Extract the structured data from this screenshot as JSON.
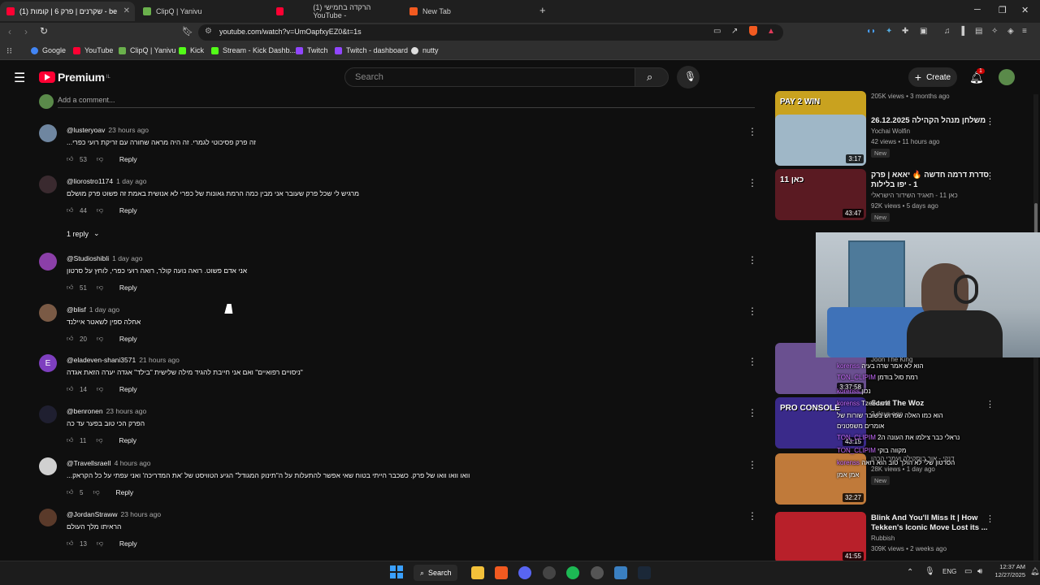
{
  "browser": {
    "tabs": [
      {
        "title": "be - שקרנים | פרק 6 | קומות (1)",
        "active": true
      },
      {
        "title": "ClipQ | Yanivu",
        "active": false
      },
      {
        "title": "הרקדה בחמישי (1) YouTube -",
        "active": false
      },
      {
        "title": "New Tab",
        "active": false
      }
    ],
    "url": "youtube.com/watch?v=UmOapfxyEZ0&t=1s",
    "bookmarks": [
      "Google",
      "YouTube",
      "ClipQ | Yanivu",
      "Kick",
      "Stream - Kick Dashb...",
      "Twitch",
      "Twitch - dashboard",
      "nutty"
    ]
  },
  "header": {
    "logo": "Premium",
    "logo_region": "IL",
    "search_placeholder": "Search",
    "create_label": "Create",
    "notif_count": "1"
  },
  "add_comment": "Add a comment...",
  "comments": [
    {
      "author": "@lusteryoav",
      "time": "23 hours ago",
      "text": "זה פרק פסיכוטי לגמרי. זה היה מראה שחורה עם זריקת רועי כפרי...",
      "likes": "53",
      "reply": "Reply",
      "avatar_color": "#6f86a0",
      "initial": ""
    },
    {
      "author": "@liorostro1174",
      "time": "1 day ago",
      "text": "מרגיש לי שכל פרק שעובר אני מבין כמה הרמת גאונות של כפרי לא אנושית באמת זה פשוט פרק מושלם",
      "likes": "44",
      "reply": "Reply",
      "avatar_color": "#3a2a2f",
      "initial": ""
    },
    {
      "author": "@Studioshibli",
      "time": "1 day ago",
      "text": "אני אדם פשוט. רואה נועה קולר, רואה רועי כפרי, לוחץ על סרטון",
      "likes": "51",
      "reply": "Reply",
      "avatar_color": "#8b3fa8",
      "initial": ""
    },
    {
      "author": "@blisf",
      "time": "1 day ago",
      "text": "אחלה ספין לשאטר איילנד",
      "likes": "20",
      "reply": "Reply",
      "avatar_color": "#7a5a45",
      "initial": ""
    },
    {
      "author": "@eladeven-shani3571",
      "time": "21 hours ago",
      "text": "\"ניסויים רפואיים\" ואם אני חייבת להגיד מילה שלישית \"בילד\" אגדה יערה הזאת אגדה",
      "likes": "14",
      "reply": "Reply",
      "avatar_color": "#7e3fbf",
      "initial": "E"
    },
    {
      "author": "@benronen",
      "time": "23 hours ago",
      "text": "הפרק הכי טוב בפער עד כה",
      "likes": "11",
      "reply": "Reply",
      "avatar_color": "#1f1f30",
      "initial": ""
    },
    {
      "author": "@TravellsraelI",
      "time": "4 hours ago",
      "text": "וואו וואו וואו של פרק. כשכבר הייתי בטוח שאי אפשר להתעלות על ה\"תינוק המגודל\" הגיע הטוויסט של 'את המדריכה' ואני עפתי על כל הקראק...",
      "likes": "5",
      "reply": "Reply",
      "avatar_color": "#d0d0d0",
      "initial": ""
    },
    {
      "author": "@JordanStraww",
      "time": "23 hours ago",
      "text": "הראיתו מלך העולם",
      "likes": "13",
      "reply": "Reply",
      "avatar_color": "#5a3a2a",
      "initial": ""
    }
  ],
  "replies_toggle": "1 reply",
  "sidebar": [
    {
      "title": "",
      "channel": "",
      "views": "205K views • 3 months ago",
      "duration": "50:01",
      "badge": "",
      "thumb": "#c9a21f",
      "thumb_text": "PAY 2 WIN"
    },
    {
      "title": "26.12.2025 משלחן מנהל הקהילה",
      "channel": "Yochai Wolfin",
      "views": "42 views • 11 hours ago",
      "duration": "3:17",
      "badge": "New",
      "thumb": "#9fb7c7",
      "thumb_text": ""
    },
    {
      "title": "סדרת דרמה חדשה 🔥 יאאא | פרק 1 - יפו בלילות",
      "channel": "כאן 11 - תאגיד השידור הישראלי",
      "views": "92K views • 5 days ago",
      "duration": "43:47",
      "badge": "New",
      "thumb": "#5a1a22",
      "thumb_text": "כאן 11"
    },
    {
      "title": "Rise & Fall of",
      "channel": "Joon The King",
      "views": "",
      "duration": "3:37:58",
      "badge": "",
      "thumb": "#6a5090",
      "thumb_text": ""
    },
    {
      "title": "Scott The Woz",
      "channel": "",
      "views": "2 days ago",
      "duration": "43:15",
      "badge": "",
      "thumb": "#3a2a8a",
      "thumb_text": "PRO CONSOLE"
    },
    {
      "title": "",
      "channel": "דנקי - אור בוסקילה ועמרי הכהן",
      "views": "28K views • 1 day ago",
      "duration": "32:27",
      "badge": "New",
      "thumb": "#c07a3a",
      "thumb_text": ""
    },
    {
      "title": "Blink And You'll Miss It | How Tekken's Iconic Move Lost its ...",
      "channel": "Rubbish",
      "views": "309K views • 2 weeks ago",
      "duration": "41:55",
      "badge": "",
      "thumb": "#b8202a",
      "thumb_text": ""
    }
  ],
  "chat": [
    {
      "user": "korenss",
      "msg": "הוא לא אמר שרה בעיה"
    },
    {
      "user": "TON_CLIPIM",
      "msg": "רמת סול בודמן"
    },
    {
      "user": "korenss",
      "msg": "נכון"
    },
    {
      "user": "korenss",
      "msg": "Tzeedane"
    },
    {
      "user": "",
      "msg": "הוא כמו האלה שפרוש בשובר שורות של"
    },
    {
      "user": "",
      "msg": "אומרים משפטנים"
    },
    {
      "user": "TON_CLIPIM",
      "msg": "נראלי כבר צילמו את העונה ה2"
    },
    {
      "user": "TON_CLIPIM",
      "msg": "מקווה בוקי"
    },
    {
      "user": "korenss",
      "msg": "הסרטון שלי לא הולך טוב הוא רואה"
    },
    {
      "user": "",
      "msg": "אמן אמן"
    }
  ],
  "taskbar": {
    "search": "Search",
    "lang": "ENG",
    "time": "12:37 AM",
    "date": "12/27/2025"
  }
}
